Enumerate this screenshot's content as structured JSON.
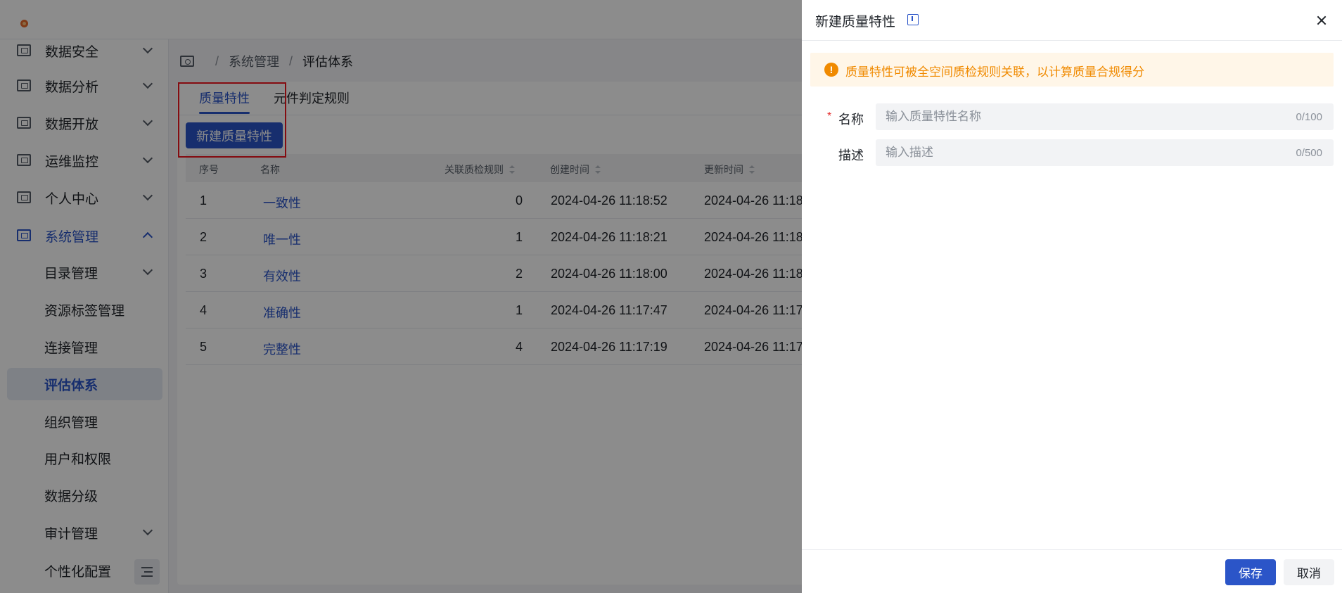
{
  "sidebar": {
    "items": [
      {
        "label": "数据安全",
        "icon": "shield-icon"
      },
      {
        "label": "数据分析",
        "icon": "chart-icon"
      },
      {
        "label": "数据开放",
        "icon": "share-icon"
      },
      {
        "label": "运维监控",
        "icon": "monitor-icon"
      },
      {
        "label": "个人中心",
        "icon": "user-icon"
      },
      {
        "label": "系统管理",
        "icon": "settings-icon"
      }
    ],
    "sub_items": [
      "目录管理",
      "资源标签管理",
      "连接管理",
      "评估体系",
      "组织管理",
      "用户和权限",
      "数据分级",
      "审计管理",
      "个性化配置"
    ]
  },
  "breadcrumb": {
    "parent": "系统管理",
    "current": "评估体系",
    "separator": "/"
  },
  "tabs": [
    "质量特性",
    "元件判定规则"
  ],
  "new_button_label": "新建质量特性",
  "table": {
    "headers": {
      "index": "序号",
      "name": "名称",
      "rules": "关联质检规则",
      "created": "创建时间",
      "updated": "更新时间"
    },
    "rows": [
      {
        "index": "1",
        "name": "一致性",
        "rules": "0",
        "created": "2024-04-26 11:18:52",
        "updated": "2024-04-26 11:18"
      },
      {
        "index": "2",
        "name": "唯一性",
        "rules": "1",
        "created": "2024-04-26 11:18:21",
        "updated": "2024-04-26 11:18"
      },
      {
        "index": "3",
        "name": "有效性",
        "rules": "2",
        "created": "2024-04-26 11:18:00",
        "updated": "2024-04-26 11:18"
      },
      {
        "index": "4",
        "name": "准确性",
        "rules": "1",
        "created": "2024-04-26 11:17:47",
        "updated": "2024-04-26 11:17"
      },
      {
        "index": "5",
        "name": "完整性",
        "rules": "4",
        "created": "2024-04-26 11:17:19",
        "updated": "2024-04-26 11:17"
      }
    ]
  },
  "drawer": {
    "title": "新建质量特性",
    "alert": "质量特性可被全空间质检规则关联，以计算质量合规得分",
    "fields": {
      "name": {
        "label": "名称",
        "required_mark": "*",
        "placeholder": "输入质量特性名称",
        "value": "",
        "counter": "0/100"
      },
      "desc": {
        "label": "描述",
        "placeholder": "输入描述",
        "value": "",
        "counter": "0/500"
      }
    },
    "save_label": "保存",
    "cancel_label": "取消"
  },
  "colors": {
    "primary": "#2b55c8",
    "warning": "#f08a00",
    "highlight": "#f0141e"
  }
}
